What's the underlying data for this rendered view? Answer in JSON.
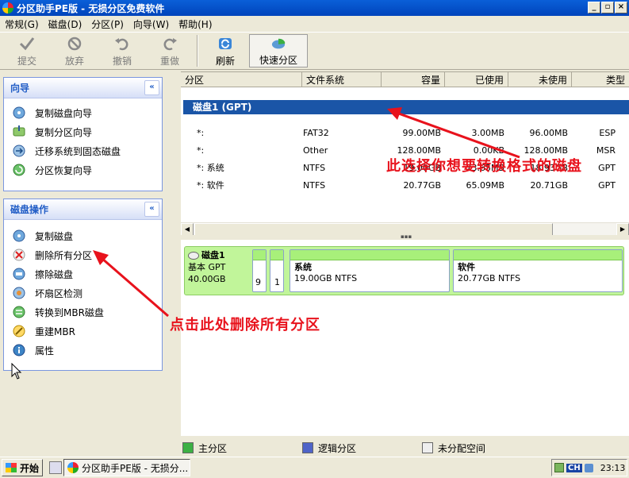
{
  "window": {
    "title": "分区助手PE版 - 无损分区免费软件",
    "buttons": [
      "_",
      "▫",
      "×"
    ]
  },
  "menu": [
    "常规(G)",
    "磁盘(D)",
    "分区(P)",
    "向导(W)",
    "帮助(H)"
  ],
  "toolbar": {
    "submit": "提交",
    "discard": "放弃",
    "undo": "撤销",
    "redo": "重做",
    "refresh": "刷新",
    "quick_partition": "快速分区"
  },
  "wizard_panel": {
    "title": "向导",
    "collapse": "«",
    "items": [
      "复制磁盘向导",
      "复制分区向导",
      "迁移系统到固态磁盘",
      "分区恢复向导"
    ]
  },
  "disk_ops_panel": {
    "title": "磁盘操作",
    "collapse": "«",
    "items": [
      "复制磁盘",
      "删除所有分区",
      "擦除磁盘",
      "坏扇区检测",
      "转换到MBR磁盘",
      "重建MBR",
      "属性"
    ]
  },
  "list": {
    "headers": [
      "分区",
      "文件系统",
      "容量",
      "已使用",
      "未使用",
      "类型"
    ],
    "disk_label": "磁盘1 (GPT)",
    "rows": [
      {
        "name": "*:",
        "fs": "FAT32",
        "cap": "99.00MB",
        "used": "3.00MB",
        "free": "96.00MB",
        "type": "ESP"
      },
      {
        "name": "*:",
        "fs": "Other",
        "cap": "128.00MB",
        "used": "0.00KB",
        "free": "128.00MB",
        "type": "MSR"
      },
      {
        "name": "*: 系统",
        "fs": "NTFS",
        "cap": "19.00GB",
        "used": "73.65MB",
        "free": "18.93GB",
        "type": "GPT"
      },
      {
        "name": "*: 软件",
        "fs": "NTFS",
        "cap": "20.77GB",
        "used": "65.09MB",
        "free": "20.71GB",
        "type": "GPT"
      }
    ]
  },
  "diskmap": {
    "disk_name": "磁盘1",
    "disk_type": "基本 GPT",
    "disk_size": "40.00GB",
    "small1": "9",
    "small2": "1",
    "part_system_name": "系统",
    "part_system_info": "19.00GB NTFS",
    "part_software_name": "软件",
    "part_software_info": "20.77GB NTFS"
  },
  "legend": {
    "primary": "主分区",
    "logical": "逻辑分区",
    "unallocated": "未分配空间"
  },
  "taskbar": {
    "start": "开始",
    "task": "分区助手PE版 - 无损分...",
    "ime": "CH",
    "time": "23:13"
  },
  "annotations": {
    "select_disk": "此选择你想要转换格式的磁盘",
    "delete_all": "点击此处删除所有分区"
  },
  "colors": {
    "accent": "#1a55a7",
    "annotation": "#e8121c",
    "partition_green": "#a8f07a"
  }
}
